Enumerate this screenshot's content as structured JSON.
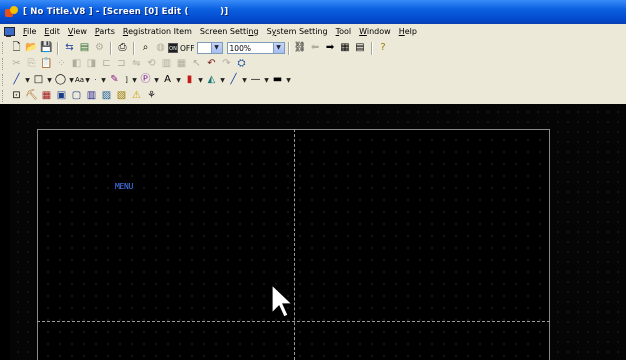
{
  "window": {
    "title": "[ No Title.V8 ] - [Screen [0] Edit (          )]"
  },
  "menubar": {
    "items": [
      {
        "label": "File",
        "u": "F"
      },
      {
        "label": "Edit",
        "u": "E"
      },
      {
        "label": "View",
        "u": "V"
      },
      {
        "label": "Parts",
        "u": "P"
      },
      {
        "label": "Registration Item",
        "u": "R"
      },
      {
        "label": "Screen Setting",
        "u": "n"
      },
      {
        "label": "System Setting",
        "u": "y"
      },
      {
        "label": "Tool",
        "u": "T"
      },
      {
        "label": "Window",
        "u": "W"
      },
      {
        "label": "Help",
        "u": "H"
      }
    ]
  },
  "toolbar1": {
    "onoff_label": "OFF",
    "onoff_badge": "ON",
    "on_label": "OFF",
    "zoom_value": "100%"
  },
  "canvas": {
    "text_items": [
      {
        "text": "MENU",
        "color": "#4d7dff"
      }
    ]
  },
  "colors": {
    "titlebar": "#0a5fe0",
    "workspace_bg": "#000000",
    "text_part": "#4d7dff"
  }
}
